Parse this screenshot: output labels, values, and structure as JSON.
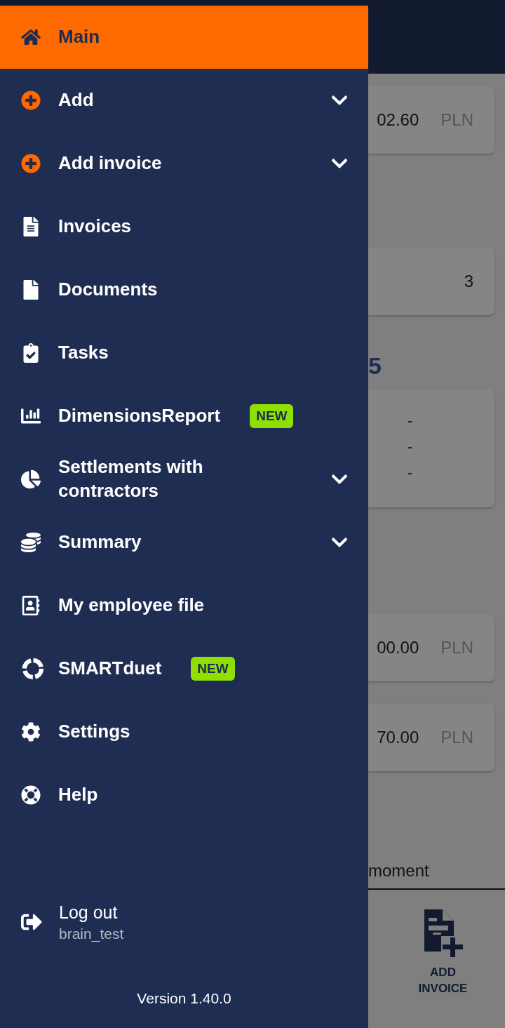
{
  "drawer": {
    "items": [
      {
        "label": "Main",
        "selected": true,
        "expandable": false
      },
      {
        "label": "Add",
        "selected": false,
        "expandable": true
      },
      {
        "label": "Add invoice",
        "selected": false,
        "expandable": true
      },
      {
        "label": "Invoices",
        "selected": false,
        "expandable": false
      },
      {
        "label": "Documents",
        "selected": false,
        "expandable": false
      },
      {
        "label": "Tasks",
        "selected": false,
        "expandable": false
      },
      {
        "label": "DimensionsReport",
        "selected": false,
        "expandable": false,
        "badge": "NEW"
      },
      {
        "label": "Settlements with contractors",
        "selected": false,
        "expandable": true
      },
      {
        "label": "Summary",
        "selected": false,
        "expandable": true
      },
      {
        "label": "My employee file",
        "selected": false,
        "expandable": false
      },
      {
        "label": "SMARTduet",
        "selected": false,
        "expandable": false,
        "badge": "NEW"
      },
      {
        "label": "Settings",
        "selected": false,
        "expandable": false
      },
      {
        "label": "Help",
        "selected": false,
        "expandable": false
      }
    ],
    "logout": {
      "label": "Log out",
      "user": "brain_test"
    },
    "version": "Version 1.40.0"
  },
  "background": {
    "blocks": [
      {
        "kind": "amount",
        "value": "02.60",
        "unit": "PLN"
      },
      {
        "kind": "count",
        "value": "3"
      },
      {
        "kind": "heading",
        "value": "5"
      },
      {
        "kind": "lines",
        "lines": [
          "-",
          "-",
          "-"
        ]
      },
      {
        "kind": "amount",
        "value": "00.00",
        "unit": "PLN"
      },
      {
        "kind": "amount",
        "value": "70.00",
        "unit": "PLN"
      },
      {
        "kind": "note",
        "value": "moment"
      }
    ],
    "bottom_nav": {
      "label": "ADD INVOICE"
    }
  }
}
